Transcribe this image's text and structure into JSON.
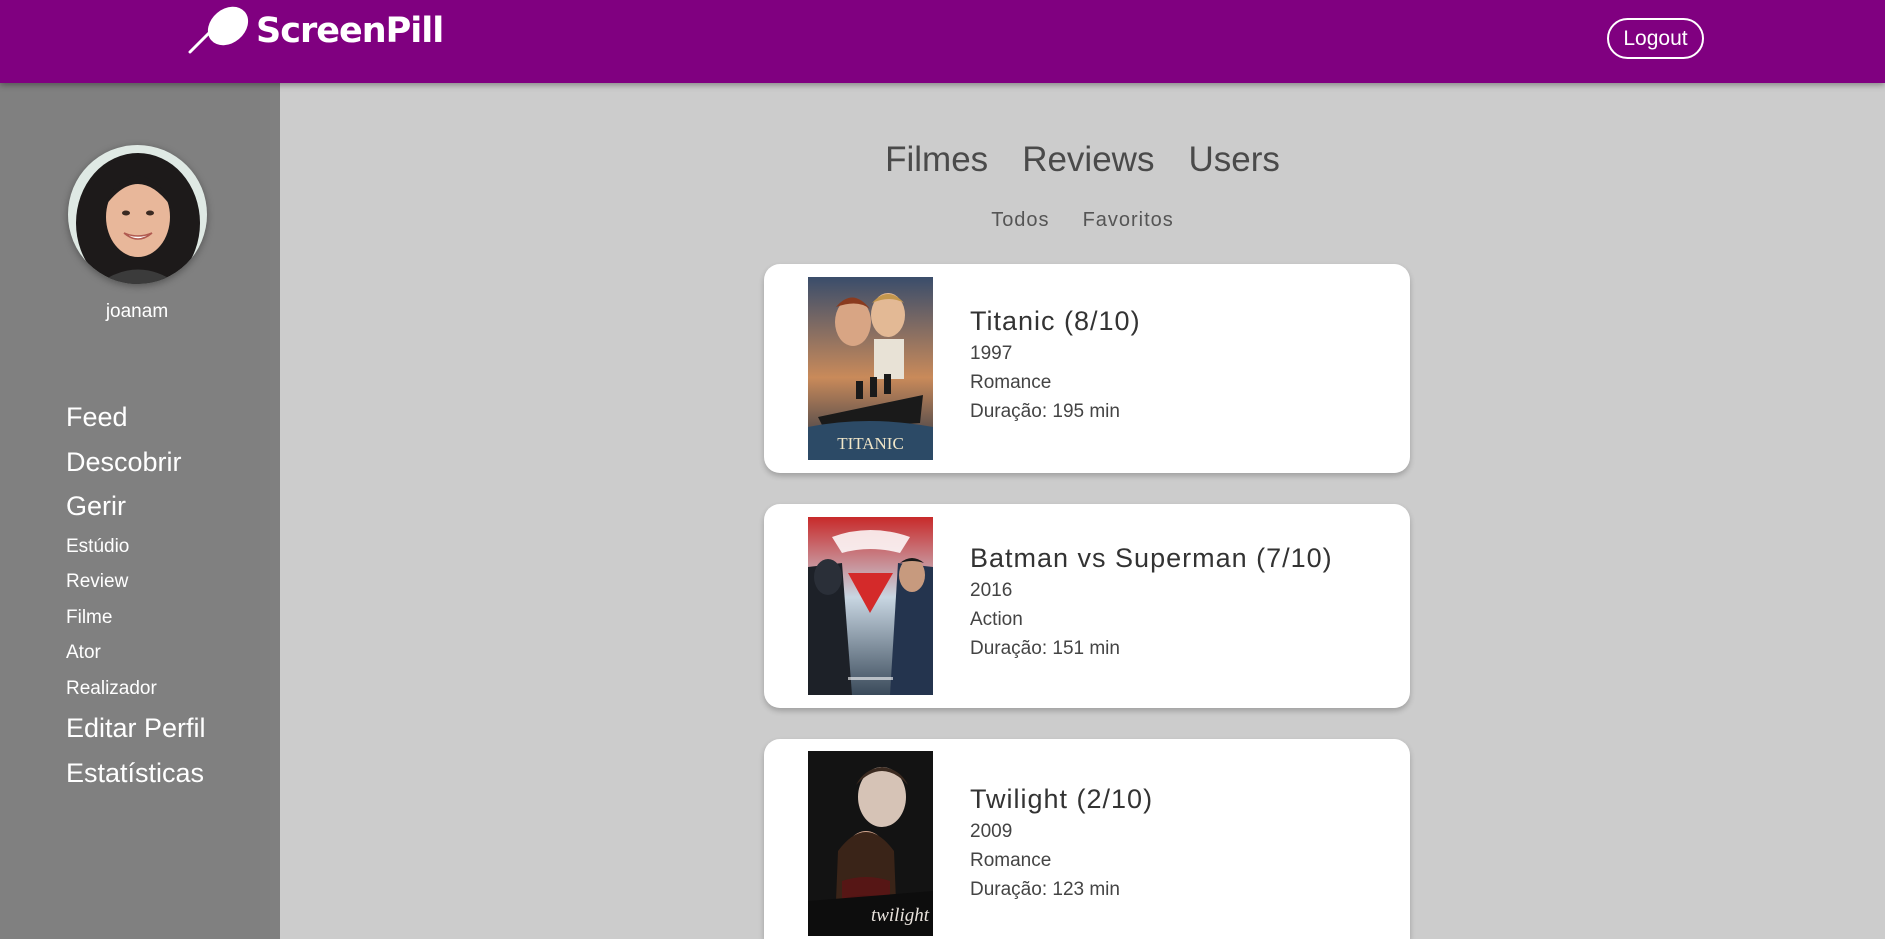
{
  "header": {
    "brand": "ScreenPill",
    "logout_label": "Logout",
    "bg_color": "#800080"
  },
  "sidebar": {
    "username": "joanam",
    "nav": [
      {
        "label": "Feed"
      },
      {
        "label": "Descobrir"
      },
      {
        "label": "Gerir"
      },
      {
        "label": "Estúdio"
      },
      {
        "label": "Review"
      },
      {
        "label": "Filme"
      },
      {
        "label": "Ator"
      },
      {
        "label": "Realizador"
      },
      {
        "label": "Editar Perfil"
      },
      {
        "label": "Estatísticas"
      }
    ]
  },
  "main": {
    "tabs": [
      {
        "label": "Filmes"
      },
      {
        "label": "Reviews"
      },
      {
        "label": "Users"
      }
    ],
    "subtabs": [
      {
        "label": "Todos"
      },
      {
        "label": "Favoritos"
      }
    ],
    "movies": [
      {
        "title": "Titanic (8/10)",
        "year": "1997",
        "genre": "Romance",
        "duration": "Duração: 195 min",
        "poster_text": "TITANIC"
      },
      {
        "title": "Batman vs Superman (7/10)",
        "year": "2016",
        "genre": "Action",
        "duration": "Duração: 151 min",
        "poster_text": ""
      },
      {
        "title": "Twilight (2/10)",
        "year": "2009",
        "genre": "Romance",
        "duration": "Duração: 123 min",
        "poster_text": "twilight"
      }
    ]
  }
}
